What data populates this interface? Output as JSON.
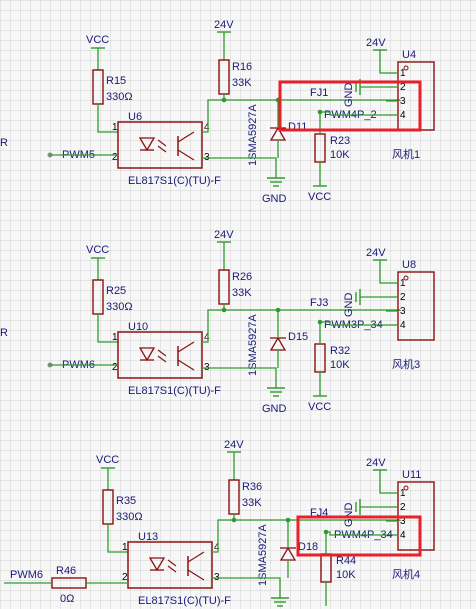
{
  "blocks": [
    {
      "vcc": "VCC",
      "v24": "24V",
      "v24b": "24V",
      "gnd": "GND",
      "vcc2": "VCC",
      "r_pull": "R15",
      "r_pull_val": "330Ω",
      "opto": "U6",
      "opto_part": "EL817S1(C)(TU)-F",
      "r_col": "R16",
      "r_col_val": "33K",
      "zener_part": "1SMA5927A",
      "diode": "D11",
      "r_base": "R23",
      "r_base_val": "10K",
      "net_fj": "FJ1",
      "net_pwm": "PWM4P_2",
      "pwm_in": "PWM5",
      "conn": "U4",
      "fan": "风机1",
      "gnd_pin": "GND",
      "pins": [
        "1",
        "2",
        "3",
        "4"
      ],
      "opto_pins": [
        "1",
        "2",
        "3",
        "4"
      ]
    },
    {
      "vcc": "VCC",
      "v24": "24V",
      "v24b": "24V",
      "gnd": "GND",
      "vcc2": "VCC",
      "r_pull": "R25",
      "r_pull_val": "330Ω",
      "opto": "U10",
      "opto_part": "EL817S1(C)(TU)-F",
      "r_col": "R26",
      "r_col_val": "33K",
      "zener_part": "1SMA5927A",
      "diode": "D15",
      "r_base": "R32",
      "r_base_val": "10K",
      "net_fj": "FJ3",
      "net_pwm": "PWM3P_34",
      "pwm_in": "PWM6",
      "conn": "U8",
      "fan": "风机3",
      "gnd_pin": "GND",
      "pins": [
        "1",
        "2",
        "3",
        "4"
      ],
      "opto_pins": [
        "1",
        "2",
        "3",
        "4"
      ]
    },
    {
      "vcc": "VCC",
      "v24": "24V",
      "v24b": "24V",
      "gnd": "",
      "vcc2": "",
      "r_pull": "R35",
      "r_pull_val": "330Ω",
      "opto": "U13",
      "opto_part": "EL817S1(C)(TU)-F",
      "r_col": "R36",
      "r_col_val": "33K",
      "zener_part": "1SMA5927A",
      "diode": "D18",
      "r_base": "R44",
      "r_base_val": "10K",
      "net_fj": "FJ4",
      "net_pwm": "PWM4P_34",
      "pwm_in": "PWM6",
      "r_in": "R46",
      "r_in_val": "0Ω",
      "conn": "U11",
      "fan": "风机4",
      "gnd_pin": "GND",
      "pins": [
        "1",
        "2",
        "3",
        "4"
      ],
      "opto_pins": [
        "1",
        "2",
        "3",
        "4"
      ]
    }
  ],
  "edge_label": "R",
  "colors": {
    "wire": "#2e9b2e",
    "component": "#8b1010",
    "label": "#1a1a7a",
    "highlight": "#e8202a",
    "background": "#f7f7f7"
  }
}
